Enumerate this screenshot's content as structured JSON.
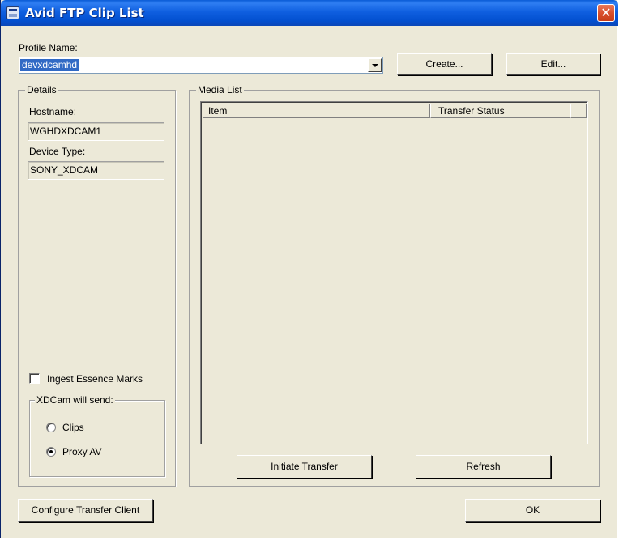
{
  "window": {
    "title": "Avid FTP Clip List",
    "close_glyph": "✕"
  },
  "profile": {
    "label": "Profile Name:",
    "value": "devxdcamhd"
  },
  "buttons": {
    "create": "Create...",
    "edit": "Edit...",
    "initiate_transfer": "Initiate Transfer",
    "refresh": "Refresh",
    "configure": "Configure Transfer Client",
    "ok": "OK"
  },
  "details": {
    "title": "Details",
    "hostname_label": "Hostname:",
    "hostname_value": "WGHDXDCAM1",
    "device_type_label": "Device Type:",
    "device_type_value": "SONY_XDCAM"
  },
  "media_list": {
    "title": "Media List",
    "columns": [
      "Item",
      "Transfer Status"
    ]
  },
  "ingest_essence_marks": {
    "label": "Ingest Essence Marks",
    "checked": false
  },
  "xdcam_send": {
    "title": "XDCam will send:",
    "options": [
      {
        "label": "Clips",
        "checked": false
      },
      {
        "label": "Proxy AV",
        "checked": true
      }
    ]
  },
  "icons": {
    "app": "app-window-icon",
    "close": "close-icon",
    "dropdown": "chevron-down-icon"
  },
  "colors": {
    "titlebar": "#0350d0",
    "selection": "#316ac5",
    "close": "#d9502d",
    "face": "#ece9d8"
  }
}
